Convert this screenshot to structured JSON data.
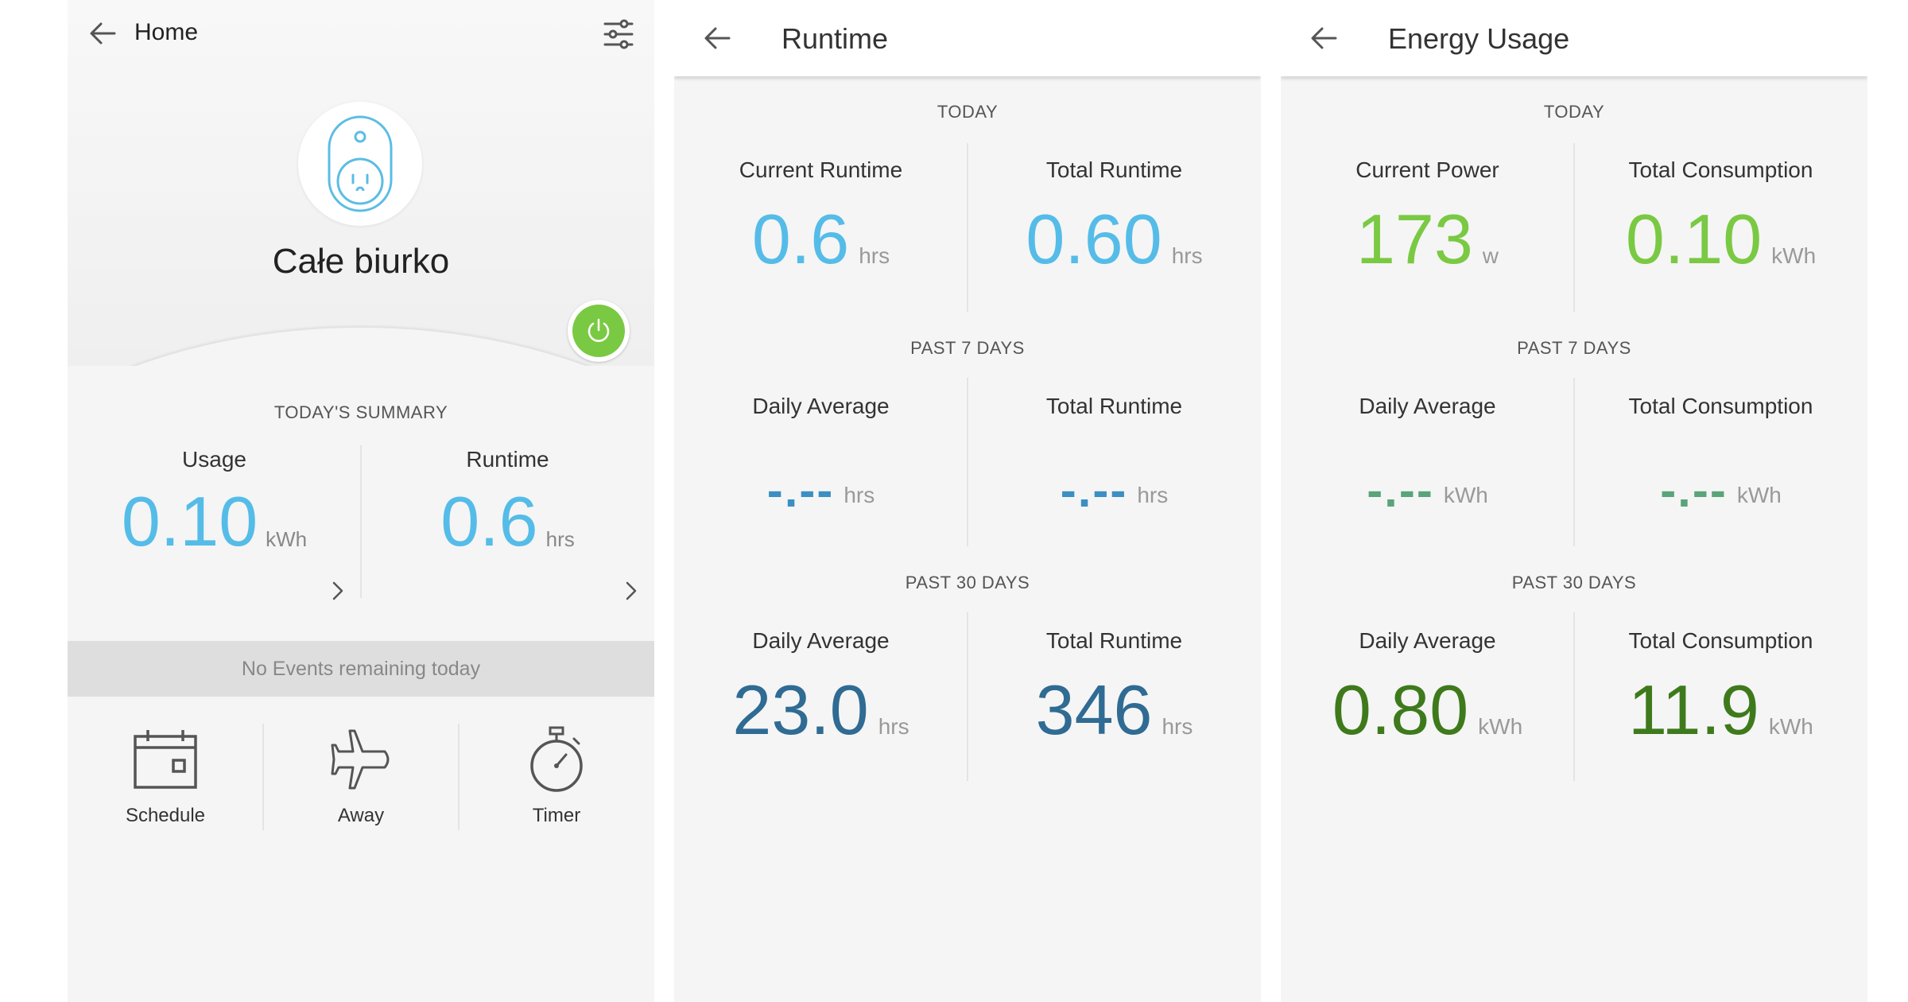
{
  "colors": {
    "blue_light": "#55bce8",
    "blue_mid": "#3b8fc2",
    "blue_dark": "#2f6b93",
    "green_light": "#7ac943",
    "green_mid": "#5aa47a",
    "green_dark": "#3e7a1c",
    "plug_outline": "#5bbde4",
    "panel_bg": "#f5f5f5"
  },
  "home": {
    "back_icon": "arrow-left-icon",
    "title": "Home",
    "settings_icon": "sliders-icon",
    "device_icon": "smart-plug-icon",
    "device_name": "Całe biurko",
    "power_icon": "power-icon",
    "power_state": "on",
    "summary_label": "TODAY'S SUMMARY",
    "usage": {
      "title": "Usage",
      "value": "0.10",
      "unit": "kWh"
    },
    "runtime": {
      "title": "Runtime",
      "value": "0.6",
      "unit": "hrs"
    },
    "chevron_icon": "chevron-right-icon",
    "events_text": "No Events remaining today",
    "actions": [
      {
        "label": "Schedule",
        "icon": "calendar-icon"
      },
      {
        "label": "Away",
        "icon": "airplane-icon"
      },
      {
        "label": "Timer",
        "icon": "stopwatch-icon"
      }
    ]
  },
  "runtime": {
    "title": "Runtime",
    "today": {
      "label": "TODAY",
      "left": {
        "title": "Current Runtime",
        "value": "0.6",
        "unit": "hrs"
      },
      "right": {
        "title": "Total Runtime",
        "value": "0.60",
        "unit": "hrs"
      }
    },
    "past7": {
      "label": "PAST 7 DAYS",
      "left": {
        "title": "Daily Average",
        "value": "-.--",
        "unit": "hrs"
      },
      "right": {
        "title": "Total Runtime",
        "value": "-.--",
        "unit": "hrs"
      }
    },
    "past30": {
      "label": "PAST 30 DAYS",
      "left": {
        "title": "Daily Average",
        "value": "23.0",
        "unit": "hrs"
      },
      "right": {
        "title": "Total Runtime",
        "value": "346",
        "unit": "hrs"
      }
    }
  },
  "energy": {
    "title": "Energy Usage",
    "today": {
      "label": "TODAY",
      "left": {
        "title": "Current Power",
        "value": "173",
        "unit": "w"
      },
      "right": {
        "title": "Total Consumption",
        "value": "0.10",
        "unit": "kWh"
      }
    },
    "past7": {
      "label": "PAST 7 DAYS",
      "left": {
        "title": "Daily Average",
        "value": "-.--",
        "unit": "kWh"
      },
      "right": {
        "title": "Total Consumption",
        "value": "-.--",
        "unit": "kWh"
      }
    },
    "past30": {
      "label": "PAST 30 DAYS",
      "left": {
        "title": "Daily Average",
        "value": "0.80",
        "unit": "kWh"
      },
      "right": {
        "title": "Total Consumption",
        "value": "11.9",
        "unit": "kWh"
      }
    }
  }
}
